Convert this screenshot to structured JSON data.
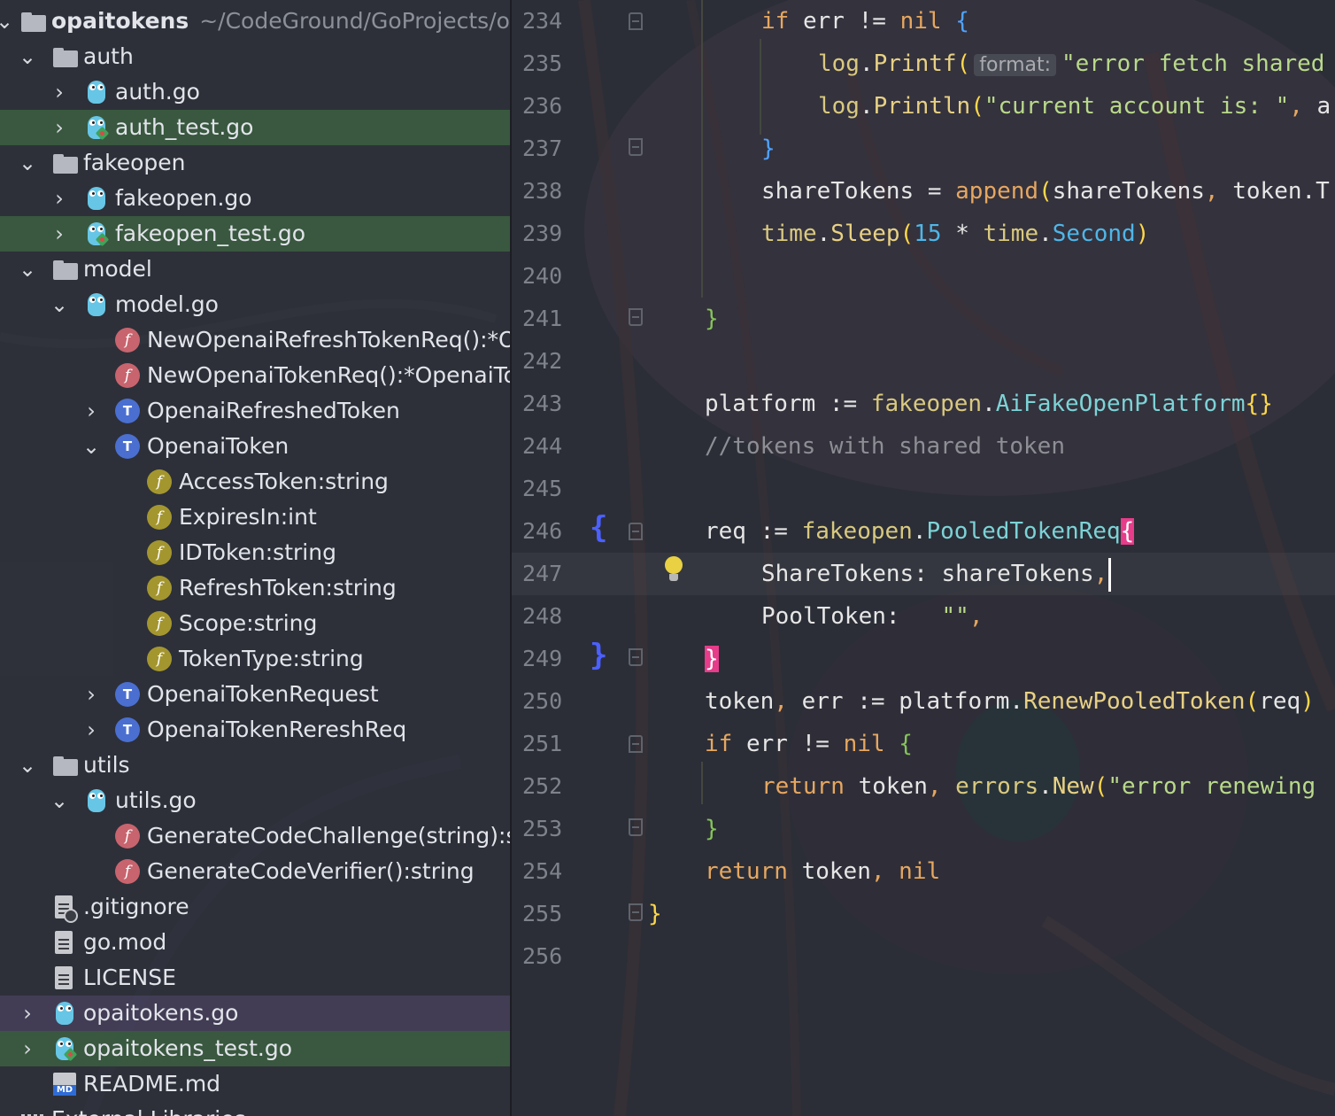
{
  "project": {
    "root_name": "opaitokens",
    "root_path": "~/CodeGround/GoProjects/opaitokens",
    "items": [
      {
        "label": "auth"
      },
      {
        "label": "auth.go"
      },
      {
        "label": "auth_test.go"
      },
      {
        "label": "fakeopen"
      },
      {
        "label": "fakeopen.go"
      },
      {
        "label": "fakeopen_test.go"
      },
      {
        "label": "model"
      },
      {
        "label": "model.go"
      },
      {
        "label": "NewOpenaiRefreshTokenReq():*OpenaiRefreshTokenReq"
      },
      {
        "label": "NewOpenaiTokenReq():*OpenaiTokenRequest"
      },
      {
        "label": "OpenaiRefreshedToken"
      },
      {
        "label": "OpenaiToken"
      },
      {
        "label": "AccessToken:string"
      },
      {
        "label": "ExpiresIn:int"
      },
      {
        "label": "IDToken:string"
      },
      {
        "label": "RefreshToken:string"
      },
      {
        "label": "Scope:string"
      },
      {
        "label": "TokenType:string"
      },
      {
        "label": "OpenaiTokenRequest"
      },
      {
        "label": "OpenaiTokenRereshReq"
      },
      {
        "label": "utils"
      },
      {
        "label": "utils.go"
      },
      {
        "label": "GenerateCodeChallenge(string):string"
      },
      {
        "label": "GenerateCodeVerifier():string"
      },
      {
        "label": ".gitignore"
      },
      {
        "label": "go.mod"
      },
      {
        "label": "LICENSE"
      },
      {
        "label": "opaitokens.go"
      },
      {
        "label": "opaitokens_test.go"
      },
      {
        "label": "README.md"
      },
      {
        "label": "External Libraries"
      }
    ],
    "icon_names": {
      "folder": "folder-icon",
      "go_file": "gopher-icon",
      "go_test_file": "gopher-test-icon",
      "function": "function-icon",
      "type": "type-icon",
      "field": "field-icon",
      "text_file": "text-file-icon",
      "markdown": "markdown-icon",
      "libraries": "libraries-icon"
    }
  },
  "editor": {
    "line_numbers": [
      "234",
      "235",
      "236",
      "237",
      "238",
      "239",
      "240",
      "241",
      "242",
      "243",
      "244",
      "245",
      "246",
      "247",
      "248",
      "249",
      "250",
      "251",
      "252",
      "253",
      "254",
      "255",
      "256"
    ],
    "current_line": "247",
    "param_hint": "format:",
    "md_badge": "MD",
    "gutter_brace_open": "{",
    "gutter_brace_close": "}",
    "tokens": {
      "if": "if",
      "err": "err",
      "neq": "!=",
      "nil": "nil",
      "lbrace": "{",
      "rbrace": "}",
      "log": "log",
      "dot": ".",
      "printf": "Printf",
      "println": "Println",
      "lparen": "(",
      "rparen": ")",
      "str_fetch": "\"error fetch shared",
      "str_account": "\"current account is: \"",
      "comma": ",",
      "a_trunc": "a",
      "shareTokens": "shareTokens",
      "assign": "=",
      "append": "append",
      "token_T": "token.T",
      "time": "time",
      "sleep": "Sleep",
      "fifteen": "15",
      "star": "*",
      "second": "Second",
      "platform": "platform",
      "define": ":=",
      "fakeopen": "fakeopen",
      "aiFakeOpenPlatform": "AiFakeOpenPlatform",
      "empty_braces": "{}",
      "comment": "//tokens with shared token",
      "req": "req",
      "pooledTokenReq": "PooledTokenReq",
      "shareTokensField": "ShareTokens",
      "colon": ":",
      "poolTokenField": "PoolToken",
      "empty_str": "\"\"",
      "token": "token",
      "renewPooledToken": "RenewPooledToken",
      "return": "return",
      "errors": "errors",
      "new": "New",
      "str_renew": "\"error renewing"
    }
  }
}
